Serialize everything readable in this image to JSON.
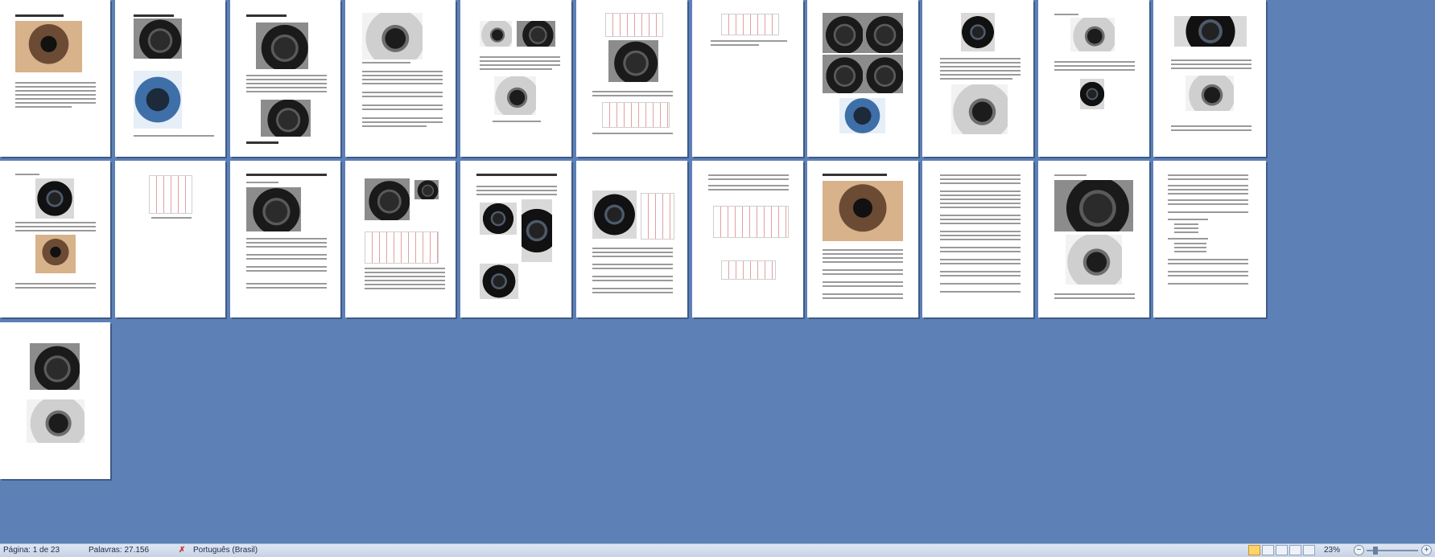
{
  "document": {
    "page_titles": [
      "1980: Nikon F3 a primeira da marca...",
      "1983: Pentax 645 médio formato",
      "1986 — Câmeras de autofoco",
      "1985: Minolta 7000 primeira câmera reflex autofoco",
      "1985: Nikon F-501 autofoco",
      "1989: Kodak DCS primeira câmera digital profissional"
    ]
  },
  "statusbar": {
    "page_info": "Página: 1 de 23",
    "word_count": "Palavras: 27.156",
    "proofing_icon": "spelling-error-icon",
    "language": "Português (Brasil)",
    "zoom": "23%",
    "zoom_minus": "−",
    "zoom_plus": "+"
  },
  "colors": {
    "background": "#5d80b6",
    "statusbar": "#dfe7f3",
    "active_view": "#ffd36b"
  }
}
